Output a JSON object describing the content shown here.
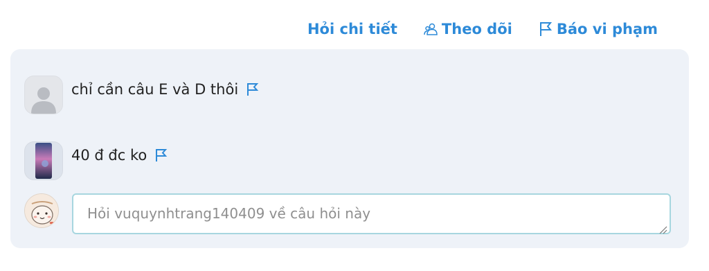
{
  "actions": {
    "ask_detail": "Hỏi chi tiết",
    "follow": "Theo dõi",
    "report": "Báo vi phạm"
  },
  "comments": [
    {
      "text": "chỉ cần câu E và D thôi",
      "avatar": "default-avatar"
    },
    {
      "text": "40 đ đc ko",
      "avatar": "photo-avatar"
    }
  ],
  "ask": {
    "placeholder": "Hỏi vuquynhtrang140409 về câu hỏi này",
    "value": ""
  },
  "colors": {
    "accent": "#2d8ad8",
    "panel_bg": "#eef2f8",
    "input_border": "#a7d6df"
  },
  "icons": [
    "follow-icon",
    "report-flag-icon",
    "comment-report-flag-icon"
  ]
}
